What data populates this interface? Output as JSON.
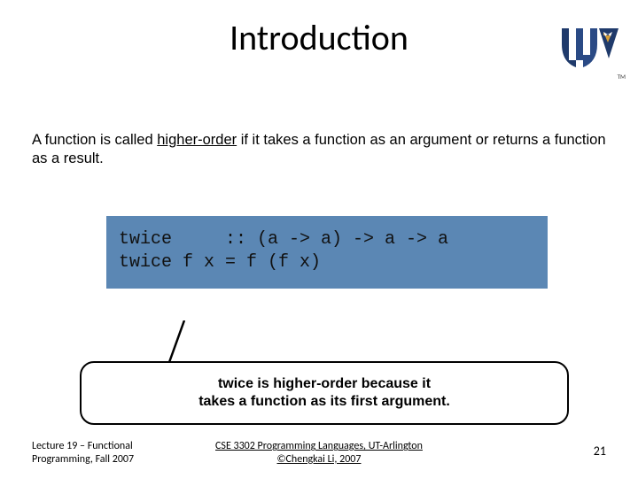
{
  "title": "Introduction",
  "intro": {
    "pre": "A function is called ",
    "term": "higher-order",
    "post": " if it takes a function as an argument or returns a function as a result."
  },
  "code": "twice     :: (a -> a) -> a -> a\ntwice f x = f (f x)",
  "callout_line1": "twice is higher-order because it",
  "callout_line2": "takes a function as its first argument.",
  "footer": {
    "left_line1": "Lecture 19 – Functional",
    "left_line2": "Programming, Fall 2007",
    "center_line1": "CSE 3302 Programming Languages, UT-Arlington",
    "center_line2": "©Chengkai Li, 2007",
    "page": "21"
  },
  "logo": {
    "tm": "TM"
  }
}
